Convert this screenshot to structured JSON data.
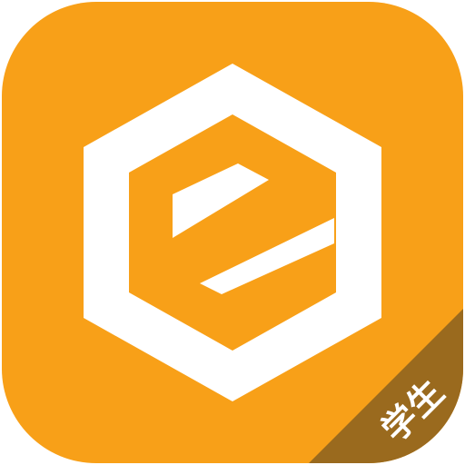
{
  "app_icon": {
    "name": "app-logo",
    "logo_letter": "e",
    "badge_text": "学生"
  },
  "colors": {
    "background": "#F8A018",
    "mark": "#FFFFFF",
    "badge": "#9A6A1E"
  }
}
